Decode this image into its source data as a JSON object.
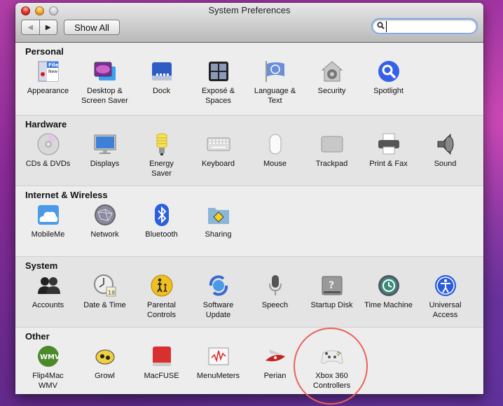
{
  "window": {
    "title": "System Preferences"
  },
  "toolbar": {
    "back_glyph": "◀",
    "forward_glyph": "▶",
    "show_all_label": "Show All",
    "search": {
      "value": "",
      "placeholder": "",
      "icon": "search-icon"
    }
  },
  "annotation": {
    "highlighted_item": "Xbox 360 Controllers",
    "color": "#ec6058"
  },
  "sections": [
    {
      "title": "Personal",
      "items": [
        {
          "label": "Appearance",
          "icon": "appearance-icon"
        },
        {
          "label": "Desktop &\nScreen Saver",
          "icon": "desktop-screensaver-icon"
        },
        {
          "label": "Dock",
          "icon": "dock-icon"
        },
        {
          "label": "Exposé &\nSpaces",
          "icon": "expose-spaces-icon"
        },
        {
          "label": "Language &\nText",
          "icon": "language-text-icon"
        },
        {
          "label": "Security",
          "icon": "security-icon"
        },
        {
          "label": "Spotlight",
          "icon": "spotlight-icon"
        }
      ]
    },
    {
      "title": "Hardware",
      "items": [
        {
          "label": "CDs & DVDs",
          "icon": "cd-dvd-icon"
        },
        {
          "label": "Displays",
          "icon": "displays-icon"
        },
        {
          "label": "Energy\nSaver",
          "icon": "energy-saver-icon"
        },
        {
          "label": "Keyboard",
          "icon": "keyboard-icon"
        },
        {
          "label": "Mouse",
          "icon": "mouse-icon"
        },
        {
          "label": "Trackpad",
          "icon": "trackpad-icon"
        },
        {
          "label": "Print & Fax",
          "icon": "printer-icon"
        },
        {
          "label": "Sound",
          "icon": "speaker-icon"
        }
      ]
    },
    {
      "title": "Internet & Wireless",
      "items": [
        {
          "label": "MobileMe",
          "icon": "mobileme-cloud-icon"
        },
        {
          "label": "Network",
          "icon": "network-globe-icon"
        },
        {
          "label": "Bluetooth",
          "icon": "bluetooth-icon"
        },
        {
          "label": "Sharing",
          "icon": "sharing-folder-icon"
        }
      ]
    },
    {
      "title": "System",
      "items": [
        {
          "label": "Accounts",
          "icon": "accounts-icon"
        },
        {
          "label": "Date & Time",
          "icon": "clock-calendar-icon",
          "badge": "18"
        },
        {
          "label": "Parental\nControls",
          "icon": "parental-controls-icon"
        },
        {
          "label": "Software\nUpdate",
          "icon": "software-update-icon"
        },
        {
          "label": "Speech",
          "icon": "microphone-icon"
        },
        {
          "label": "Startup Disk",
          "icon": "startup-disk-icon"
        },
        {
          "label": "Time Machine",
          "icon": "time-machine-icon"
        },
        {
          "label": "Universal\nAccess",
          "icon": "universal-access-icon"
        }
      ]
    },
    {
      "title": "Other",
      "items": [
        {
          "label": "Flip4Mac\nWMV",
          "icon": "flip4mac-wmv-icon",
          "badge": "WMV"
        },
        {
          "label": "Growl",
          "icon": "growl-icon"
        },
        {
          "label": "MacFUSE",
          "icon": "macfuse-icon"
        },
        {
          "label": "MenuMeters",
          "icon": "menumeters-icon"
        },
        {
          "label": "Perian",
          "icon": "perian-knife-icon"
        },
        {
          "label": "Xbox 360\nControllers",
          "icon": "xbox-controller-icon"
        }
      ]
    }
  ]
}
